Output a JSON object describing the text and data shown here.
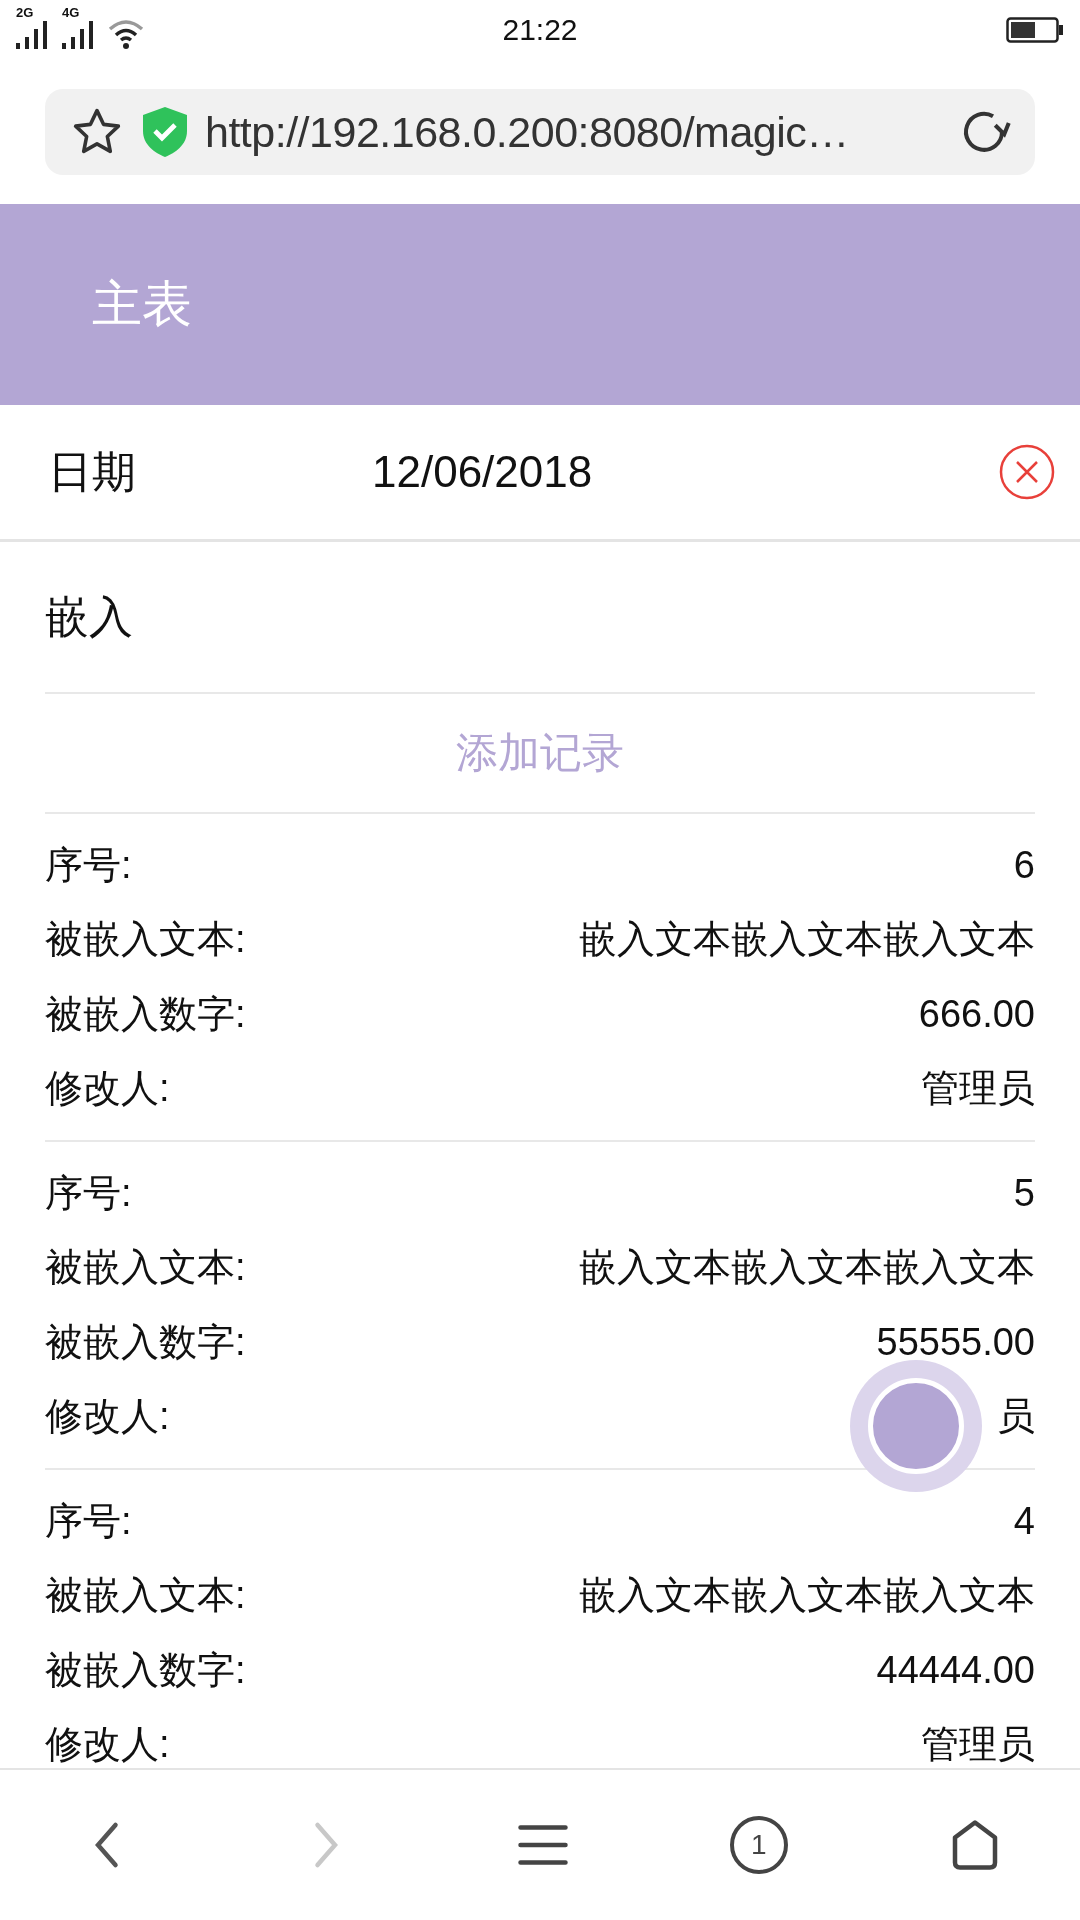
{
  "status_bar": {
    "networks": [
      "2G",
      "4G"
    ],
    "time": "21:22"
  },
  "address_bar": {
    "url": "http://192.168.0.200:8080/magic…"
  },
  "header": {
    "title": "主表"
  },
  "date_field": {
    "label": "日期",
    "value": "12/06/2018"
  },
  "section": {
    "title": "嵌入",
    "add_button": "添加记录"
  },
  "records": [
    {
      "fields": [
        {
          "label": "序号:",
          "value": "6"
        },
        {
          "label": "被嵌入文本:",
          "value": "嵌入文本嵌入文本嵌入文本"
        },
        {
          "label": "被嵌入数字:",
          "value": "666.00"
        },
        {
          "label": "修改人:",
          "value": "管理员"
        }
      ]
    },
    {
      "fields": [
        {
          "label": "序号:",
          "value": "5"
        },
        {
          "label": "被嵌入文本:",
          "value": "嵌入文本嵌入文本嵌入文本"
        },
        {
          "label": "被嵌入数字:",
          "value": "55555.00"
        },
        {
          "label": "修改人:",
          "value": "员"
        }
      ]
    },
    {
      "fields": [
        {
          "label": "序号:",
          "value": "4"
        },
        {
          "label": "被嵌入文本:",
          "value": "嵌入文本嵌入文本嵌入文本"
        },
        {
          "label": "被嵌入数字:",
          "value": "44444.00"
        },
        {
          "label": "修改人:",
          "value": "管理员"
        }
      ]
    }
  ],
  "bottom_nav": {
    "forward_disabled": true,
    "tab_count": "1"
  }
}
